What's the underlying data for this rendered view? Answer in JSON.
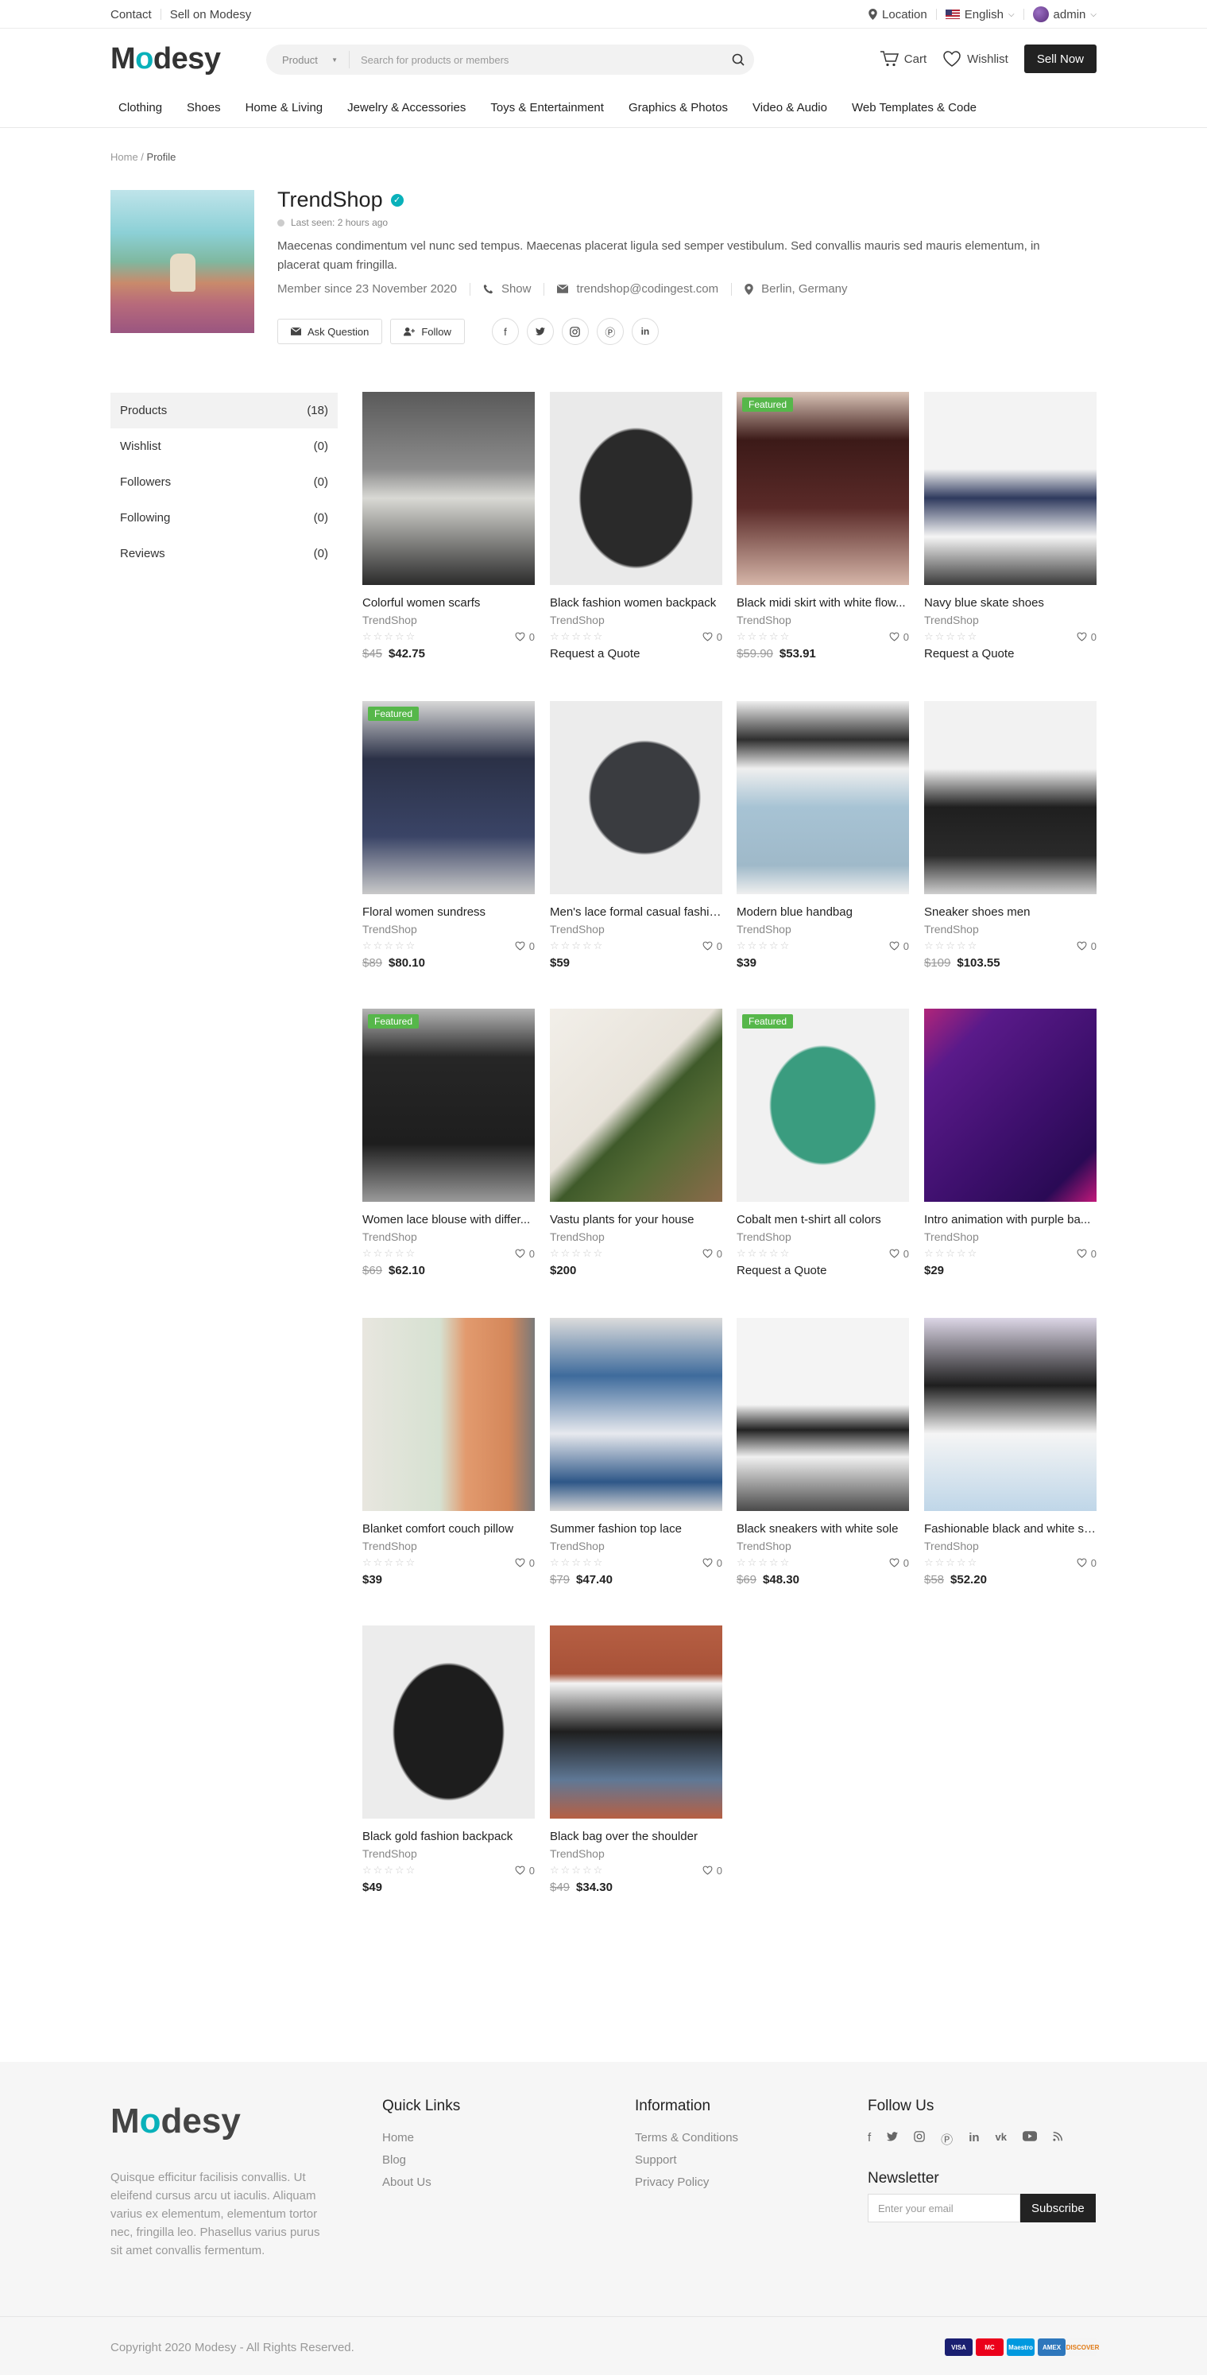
{
  "topbar": {
    "contact": "Contact",
    "sell_on": "Sell on Modesy",
    "location": "Location",
    "language": "English",
    "user": "admin"
  },
  "header": {
    "logo_prefix": "M",
    "logo_o": "o",
    "logo_suffix": "desy",
    "search_category": "Product",
    "search_placeholder": "Search for products or members",
    "cart": "Cart",
    "wishlist": "Wishlist",
    "sell_now": "Sell Now",
    "nav": [
      "Clothing",
      "Shoes",
      "Home & Living",
      "Jewelry & Accessories",
      "Toys & Entertainment",
      "Graphics & Photos",
      "Video & Audio",
      "Web Templates & Code"
    ]
  },
  "breadcrumb": {
    "home": "Home",
    "sep": " / ",
    "current": "Profile"
  },
  "profile": {
    "name": "TrendShop",
    "last_seen": "Last seen: 2 hours ago",
    "description": "Maecenas condimentum vel nunc sed tempus. Maecenas placerat ligula sed semper vestibulum. Sed convallis mauris sed mauris elementum, in placerat quam fringilla.",
    "member_since": "Member since 23 November 2020",
    "phone": "Show",
    "email": "trendshop@codingest.com",
    "location": "Berlin, Germany",
    "ask_question": "Ask Question",
    "follow": "Follow"
  },
  "sidebar": [
    {
      "label": "Products",
      "count": "(18)"
    },
    {
      "label": "Wishlist",
      "count": "(0)"
    },
    {
      "label": "Followers",
      "count": "(0)"
    },
    {
      "label": "Following",
      "count": "(0)"
    },
    {
      "label": "Reviews",
      "count": "(0)"
    }
  ],
  "products": [
    {
      "title": "Colorful women scarfs",
      "seller": "TrendShop",
      "likes": "0",
      "old": "$45",
      "price": "$42.75",
      "featured": false,
      "bg": "linear-gradient(180deg,#5a5a5a 0%,#8b8b8b 40%,#d9d9d4 55%,#2b2b2b 100%)"
    },
    {
      "title": "Black fashion women backpack",
      "seller": "TrendShop",
      "likes": "0",
      "old": "",
      "price": "Request a Quote",
      "featured": false,
      "bg": "radial-gradient(ellipse at 50% 55%,#2a2a2a 0 45%,#eaeaea 47%)"
    },
    {
      "title": "Black midi skirt with white flow...",
      "seller": "TrendShop",
      "likes": "0",
      "old": "$59.90",
      "price": "$53.91",
      "featured": true,
      "bg": "linear-gradient(180deg,#d9c3b6 0%,#3c1a18 25%,#5a2a28 60%,#d5b5a8 100%)"
    },
    {
      "title": "Navy blue skate shoes",
      "seller": "TrendShop",
      "likes": "0",
      "old": "",
      "price": "Request a Quote",
      "featured": false,
      "bg": "linear-gradient(180deg,#f3f3f3 0%,#f3f3f3 40%,#2f3a5e 55%,#f5f5f5 75%,#3a3a3a 100%)"
    },
    {
      "title": "Floral women sundress",
      "seller": "TrendShop",
      "likes": "0",
      "old": "$89",
      "price": "$80.10",
      "featured": true,
      "bg": "linear-gradient(180deg,#d8d8d8 0%,#2b3147 30%,#3a4466 70%,#c9c9c9 100%)"
    },
    {
      "title": "Men's lace formal casual fashio...",
      "seller": "TrendShop",
      "likes": "0",
      "old": "",
      "price": "$59",
      "featured": false,
      "bg": "radial-gradient(ellipse at 55% 50%,#3a3c40 0 40%,#ececec 42%)"
    },
    {
      "title": "Modern blue handbag",
      "seller": "TrendShop",
      "likes": "0",
      "old": "",
      "price": "$39",
      "featured": false,
      "bg": "linear-gradient(180deg,#efefef 0%,#2f2f2f 20%,#efefef 35%,#a7c3d4 55%,#9fb9c9 85%,#efefef 100%)"
    },
    {
      "title": "Sneaker shoes men",
      "seller": "TrendShop",
      "likes": "0",
      "old": "$109",
      "price": "$103.55",
      "featured": false,
      "bg": "linear-gradient(180deg,#f2f2f2 0%,#f2f2f2 35%,#1f1f1f 55%,#2a2a2a 80%,#cfcfcf 100%)"
    },
    {
      "title": "Women lace blouse with differ...",
      "seller": "TrendShop",
      "likes": "0",
      "old": "$69",
      "price": "$62.10",
      "featured": true,
      "bg": "linear-gradient(180deg,#b5b5b5 0%,#262626 25%,#1e1e1e 70%,#9a9a9a 100%)"
    },
    {
      "title": "Vastu plants for your house",
      "seller": "TrendShop",
      "likes": "0",
      "old": "",
      "price": "$200",
      "featured": false,
      "bg": "linear-gradient(135deg,#f2efe9 0%,#e8e3da 45%,#3f5a2a 55%,#556b35 70%,#8a6a4a 100%)"
    },
    {
      "title": "Cobalt men t-shirt all colors",
      "seller": "TrendShop",
      "likes": "0",
      "old": "",
      "price": "Request a Quote",
      "featured": true,
      "bg": "radial-gradient(ellipse at 50% 50%,#3a9c7f 0 42%,#f1f1f1 44%)"
    },
    {
      "title": "Intro animation with purple ba...",
      "seller": "TrendShop",
      "likes": "0",
      "old": "",
      "price": "$29",
      "featured": false,
      "bg": "linear-gradient(135deg,#b0257a 0%,#5a1a8a 20%,#3c0f6b 60%,#2a0a55 85%,#c2187a 100%)"
    },
    {
      "title": "Blanket comfort couch pillow",
      "seller": "TrendShop",
      "likes": "0",
      "old": "",
      "price": "$39",
      "featured": false,
      "bg": "linear-gradient(90deg,#e8e6df 0%,#d6e1d1 45%,#e29a6e 60%,#d4875a 85%,#7a7a7a 100%)"
    },
    {
      "title": "Summer fashion top lace",
      "seller": "TrendShop",
      "likes": "0",
      "old": "$79",
      "price": "$47.40",
      "featured": false,
      "bg": "linear-gradient(180deg,#dcdcdc 0%,#3e6b9c 30%,#e7e9ee 60%,#2e5788 85%,#d8d8d8 100%)"
    },
    {
      "title": "Black sneakers with white sole",
      "seller": "TrendShop",
      "likes": "0",
      "old": "$69",
      "price": "$48.30",
      "featured": false,
      "bg": "linear-gradient(180deg,#f4f4f4 0%,#f4f4f4 45%,#222 58%,#f0f0f0 72%,#4a4a4a 100%)"
    },
    {
      "title": "Fashionable black and white sn...",
      "seller": "TrendShop",
      "likes": "0",
      "old": "$58",
      "price": "$52.20",
      "featured": false,
      "bg": "linear-gradient(180deg,#dcd6e6 0%,#1e1e1e 35%,#f5f5f5 60%,#bfd6e8 100%)"
    },
    {
      "title": "Black gold fashion backpack",
      "seller": "TrendShop",
      "likes": "0",
      "old": "",
      "price": "$49",
      "featured": false,
      "bg": "radial-gradient(ellipse at 50% 55%,#1d1d1d 0 44%,#ececec 46%)"
    },
    {
      "title": "Black bag over the shoulder",
      "seller": "TrendShop",
      "likes": "0",
      "old": "$49",
      "price": "$34.30",
      "featured": false,
      "bg": "linear-gradient(180deg,#b65f43 0%,#a85238 25%,#f4f4f4 30%,#1f1f1f 55%,#5f7896 80%,#b65f43 100%)"
    }
  ],
  "footer": {
    "about": "Quisque efficitur facilisis convallis. Ut eleifend cursus arcu ut iaculis. Aliquam varius ex elementum, elementum tortor nec, fringilla leo. Phasellus varius purus sit amet convallis fermentum.",
    "quick_links_title": "Quick Links",
    "quick_links": [
      "Home",
      "Blog",
      "About Us"
    ],
    "information_title": "Information",
    "information": [
      "Terms & Conditions",
      "Support",
      "Privacy Policy"
    ],
    "follow_title": "Follow Us",
    "newsletter_title": "Newsletter",
    "newsletter_placeholder": "Enter your email",
    "subscribe": "Subscribe",
    "copyright": "Copyright 2020 Modesy - All Rights Reserved.",
    "card_labels": [
      "VISA",
      "MC",
      "Maestro",
      "AMEX",
      "DISCOVER"
    ],
    "card_colors": [
      "#1a1f71",
      "#eb001b",
      "#0099df",
      "#2e77bc",
      "#f5f5f5"
    ]
  },
  "colors": {
    "accent": "#09b1ba",
    "featured": "#56b74a",
    "dark": "#222222"
  }
}
